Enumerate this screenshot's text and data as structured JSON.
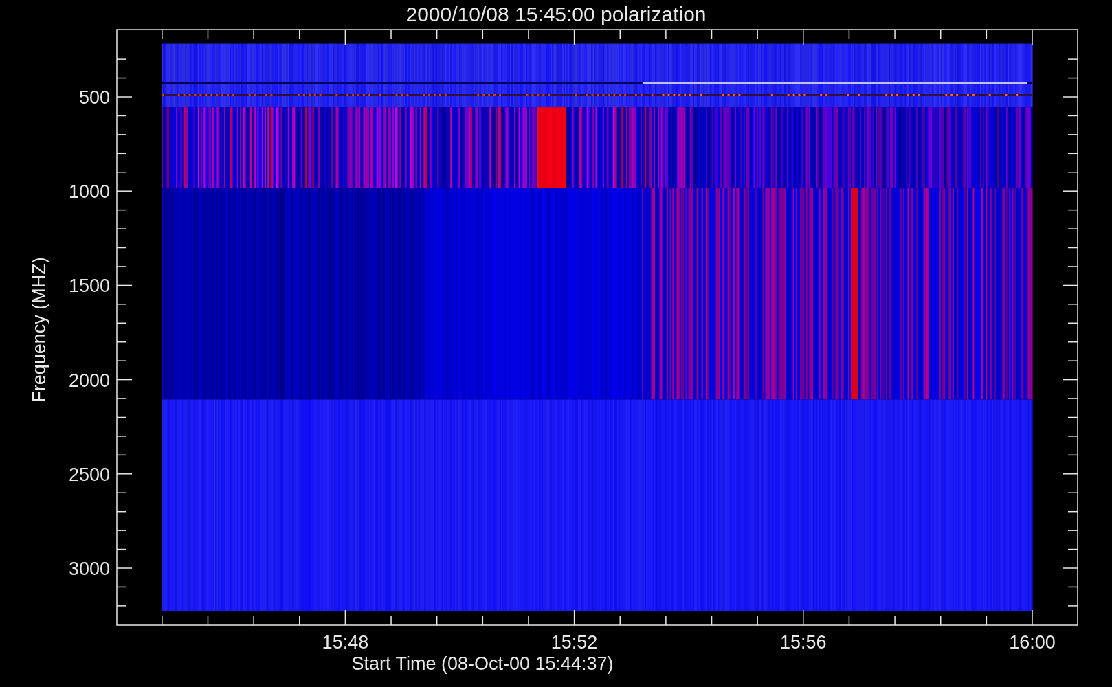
{
  "title": "2000/10/08 15:45:00 polarization",
  "y_axis": {
    "label": "Frequency (MHZ)",
    "tick_labels": [
      "500",
      "1000",
      "1500",
      "2000",
      "2500",
      "3000"
    ]
  },
  "x_axis": {
    "label": "Start Time (08-Oct-00 15:44:37)",
    "tick_labels": [
      "15:48",
      "15:52",
      "15:56",
      "16:00"
    ]
  }
}
